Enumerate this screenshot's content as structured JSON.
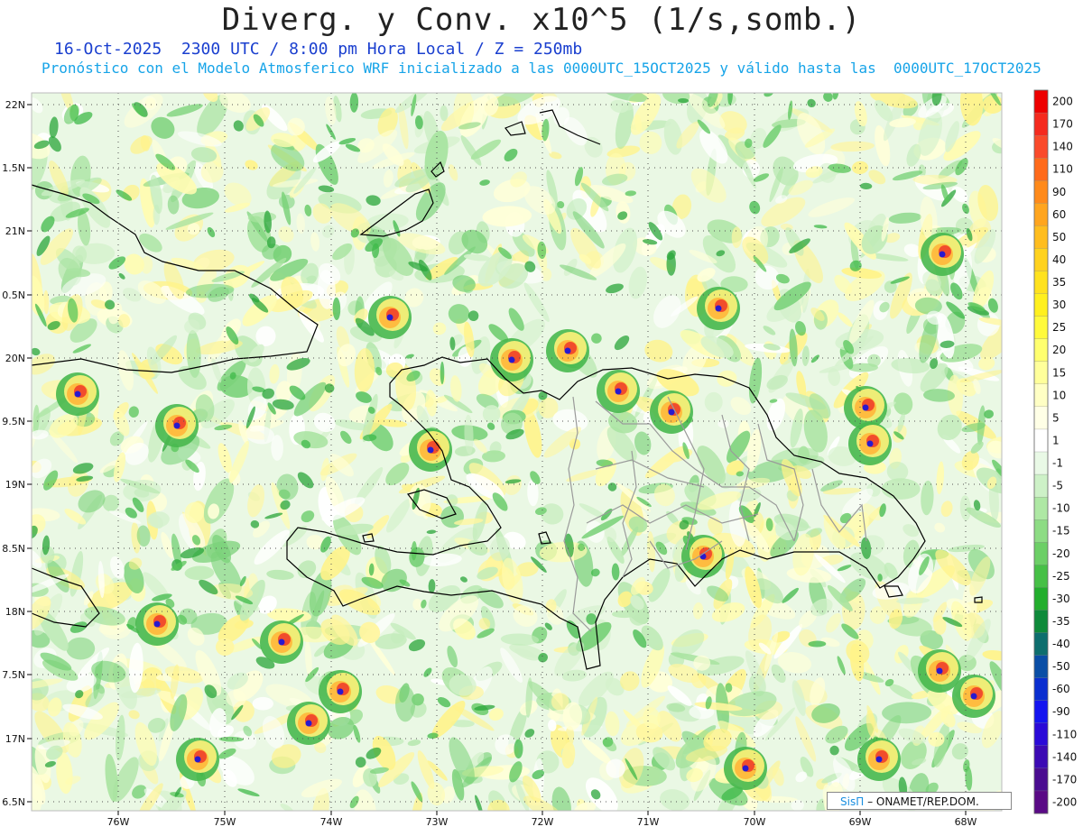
{
  "title": "Diverg. y Conv. x10^5 (1/s,somb.)",
  "subtitle_line1": "16-Oct-2025  2300 UTC / 8:00 pm Hora Local / Z = 250mb",
  "subtitle_line2": "Pronóstico con el Modelo Atmosferico WRF inicializado a las 0000UTC_15OCT2025 y válido hasta las  0000UTC_17OCT2025",
  "credit": {
    "brand": "SisΠ",
    "text": "– ONAMET/REP.DOM."
  },
  "lat_labels": [
    "22N",
    "1.5N",
    "21N",
    "0.5N",
    "20N",
    "9.5N",
    "19N",
    "8.5N",
    "18N",
    "7.5N",
    "17N",
    "6.5N"
  ],
  "lon_labels": [
    "76W",
    "75W",
    "74W",
    "73W",
    "72W",
    "71W",
    "70W",
    "69W",
    "68W"
  ],
  "colorbar": {
    "labels": [
      "200",
      "170",
      "140",
      "110",
      "90",
      "60",
      "50",
      "40",
      "35",
      "30",
      "25",
      "20",
      "15",
      "10",
      "5",
      "1",
      "-1",
      "-5",
      "-10",
      "-15",
      "-20",
      "-25",
      "-30",
      "-35",
      "-40",
      "-50",
      "-60",
      "-90",
      "-110",
      "-140",
      "-170",
      "-200"
    ],
    "colors": [
      "#ee0000",
      "#f52a1e",
      "#fa4a2a",
      "#ff6a1a",
      "#ff8a1a",
      "#ffa51e",
      "#ffbd1e",
      "#ffd21e",
      "#ffe21e",
      "#fff01e",
      "#fffa3c",
      "#ffff6e",
      "#ffff9a",
      "#ffffc4",
      "#ffffe6",
      "#ffffff",
      "#e9f9e6",
      "#cdf1c7",
      "#aee8a4",
      "#8ddc84",
      "#6ccf66",
      "#46c046",
      "#22ae2c",
      "#0e8a3a",
      "#0d6e6e",
      "#0a4ea6",
      "#0a2ed0",
      "#1414f0",
      "#2a0ad8",
      "#3c0ab4",
      "#4a0c90",
      "#5a0a86"
    ]
  }
}
